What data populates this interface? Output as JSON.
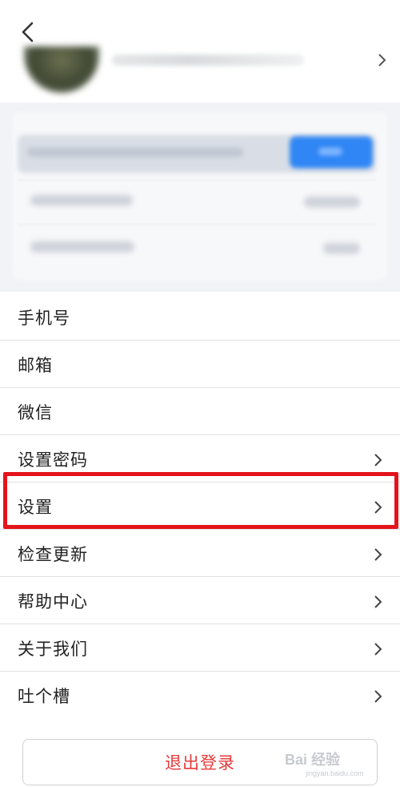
{
  "header": {
    "back_icon": "chevron-left-icon",
    "profile_chevron_icon": "chevron-right-icon"
  },
  "menu": {
    "items": [
      {
        "label": "手机号",
        "has_chevron": false
      },
      {
        "label": "邮箱",
        "has_chevron": false
      },
      {
        "label": "微信",
        "has_chevron": false
      },
      {
        "label": "设置密码",
        "has_chevron": true
      },
      {
        "label": "设置",
        "has_chevron": true,
        "highlighted": true
      },
      {
        "label": "检查更新",
        "has_chevron": true
      },
      {
        "label": "帮助中心",
        "has_chevron": true
      },
      {
        "label": "关于我们",
        "has_chevron": true
      },
      {
        "label": "吐个槽",
        "has_chevron": true
      }
    ]
  },
  "footer": {
    "logout_label": "退出登录"
  },
  "watermark": {
    "logo_text": "Bai 经验",
    "sub_text": "jingyan.baidu.com"
  },
  "colors": {
    "highlight_border": "#e3141b",
    "logout_text": "#e63b3b",
    "blurred_button": "#2f86f4",
    "band_bg": "#f1f3f6"
  }
}
